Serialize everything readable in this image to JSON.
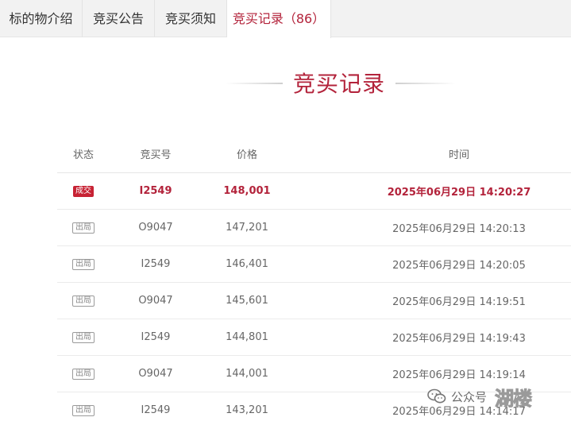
{
  "tabs": [
    {
      "label": "标的物介绍"
    },
    {
      "label": "竞买公告"
    },
    {
      "label": "竞买须知"
    },
    {
      "label": "竞买记录（86）"
    }
  ],
  "section": {
    "title": "竞买记录"
  },
  "table": {
    "headers": [
      "状态",
      "竞买号",
      "价格",
      "时间"
    ],
    "rows": [
      {
        "status": "成交",
        "bidder": "I2549",
        "price": "148,001",
        "time": "2025年06月29日 14:20:27"
      },
      {
        "status": "出局",
        "bidder": "O9047",
        "price": "147,201",
        "time": "2025年06月29日 14:20:13"
      },
      {
        "status": "出局",
        "bidder": "I2549",
        "price": "146,401",
        "time": "2025年06月29日 14:20:05"
      },
      {
        "status": "出局",
        "bidder": "O9047",
        "price": "145,601",
        "time": "2025年06月29日 14:19:51"
      },
      {
        "status": "出局",
        "bidder": "I2549",
        "price": "144,801",
        "time": "2025年06月29日 14:19:43"
      },
      {
        "status": "出局",
        "bidder": "O9047",
        "price": "144,001",
        "time": "2025年06月29日 14:19:14"
      },
      {
        "status": "出局",
        "bidder": "I2549",
        "price": "143,201",
        "time": "2025年06月29日 14:14:17"
      }
    ]
  },
  "watermark": {
    "label": "公众号",
    "logo": "湖楼"
  },
  "colors": {
    "accent": "#b3233b",
    "won_badge": "#c72234",
    "tab_bg": "#f2f2f2"
  }
}
